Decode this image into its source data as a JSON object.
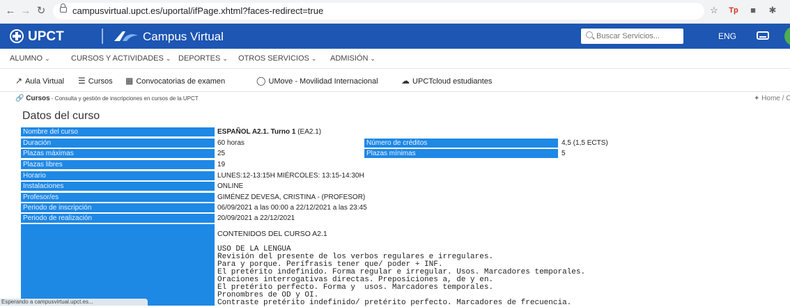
{
  "browser": {
    "url": "campusvirtual.upct.es/uportal/ifPage.xhtml?faces-redirect=true",
    "status_text": "Esperando a campusvirtual.upct.es..."
  },
  "header": {
    "brand": "UPCT",
    "app_title": "Campus Virtual",
    "search_placeholder": "Buscar Servicios...",
    "language": "ENG",
    "colors": {
      "bar": "#1d56b3",
      "label_cell": "#1e88e5"
    }
  },
  "nav": {
    "items": [
      {
        "label": "ALUMNO"
      },
      {
        "label": "CURSOS Y ACTIVIDADES"
      },
      {
        "label": "DEPORTES"
      },
      {
        "label": "OTROS SERVICIOS"
      },
      {
        "label": "ADMISIÓN"
      }
    ]
  },
  "quick_links": [
    {
      "label": "Aula Virtual",
      "icon": "external-window-icon"
    },
    {
      "label": "Cursos",
      "icon": "courses-icon"
    },
    {
      "label": "Convocatorias de examen",
      "icon": "calendar-icon"
    },
    {
      "label": "UMove - Movilidad Internacional",
      "icon": "globe-icon"
    },
    {
      "label": "UPCTcloud estudiantes",
      "icon": "cloud-icon"
    }
  ],
  "breadcrumb": {
    "section": "Cursos",
    "description": " - Consulta y gestión de inscripciones en cursos de la UPCT",
    "home": "Home",
    "next": "/  Cu"
  },
  "page_title": "Datos del curso",
  "course": {
    "rows": [
      {
        "label": "Nombre del curso",
        "value_bold": "ESPAÑOL A2.1. Turno 1",
        "value": " (EA2.1)"
      },
      {
        "label": "Duración",
        "value": "60 horas",
        "label2": "Número de créditos",
        "value2": "4,5 (1,5 ECTS)"
      },
      {
        "label": "Plazas máximas",
        "value": "25",
        "label2": "Plazas mínimas",
        "value2": "5"
      },
      {
        "label": "Plazas libres",
        "value": "19"
      },
      {
        "label": "Horario",
        "value": "LUNES:12-13:15H MIÉRCOLES: 13:15-14:30H"
      },
      {
        "label": "Instalaciones",
        "value": "ONLINE"
      },
      {
        "label": "Profesor/es",
        "value": "GIMÉNEZ DEVESA, CRISTINA - (PROFESOR)"
      },
      {
        "label": "Periodo de inscripción",
        "value": "06/09/2021 a las 00:00 a 22/12/2021 a las 23:45"
      },
      {
        "label": "Periodo de realización",
        "value": "20/09/2021 a 22/12/2021"
      }
    ],
    "contents_title": "CONTENIDOS DEL CURSO A2.1",
    "contents_lines": [
      "USO DE LA LENGUA",
      "Revisión del presente de los verbos regulares e irregulares.",
      "Para y porque. Perífrasis tener que/ poder + INF.",
      "El pretérito indefinido. Forma regular e irregular. Usos. Marcadores temporales.",
      "Oraciones interrogativas directas. Preposiciones a, de y en.",
      "El pretérito perfecto. Forma y  usos. Marcadores temporales.",
      "Pronombres de OD y OI.",
      "Contraste pretérito indefinido/ pretérito perfecto. Marcadores de frecuencia."
    ]
  }
}
